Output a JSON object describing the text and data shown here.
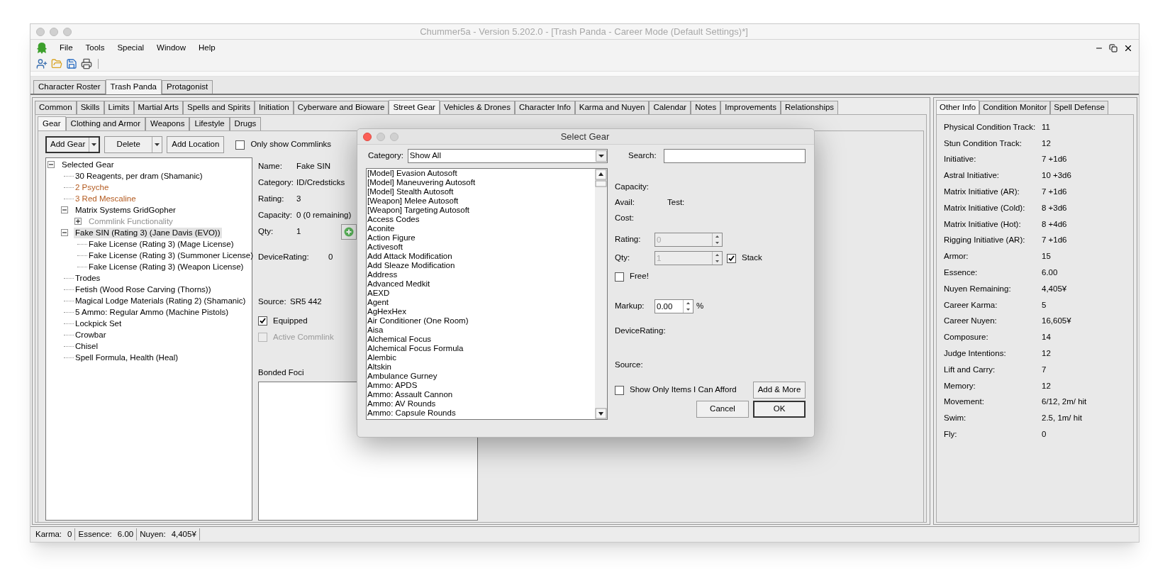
{
  "window": {
    "title": "Chummer5a - Version 5.202.0 - [Trash Panda - Career Mode (Default Settings)*]"
  },
  "menu": [
    "File",
    "Tools",
    "Special",
    "Window",
    "Help"
  ],
  "character_tabs": [
    {
      "label": "Character Roster",
      "selected": false
    },
    {
      "label": "Trash Panda",
      "selected": true
    },
    {
      "label": "Protagonist",
      "selected": false
    }
  ],
  "main_tabs": [
    {
      "label": "Common",
      "selected": false
    },
    {
      "label": "Skills",
      "selected": false
    },
    {
      "label": "Limits",
      "selected": false
    },
    {
      "label": "Martial Arts",
      "selected": false
    },
    {
      "label": "Spells and Spirits",
      "selected": false
    },
    {
      "label": "Initiation",
      "selected": false
    },
    {
      "label": "Cyberware and Bioware",
      "selected": false
    },
    {
      "label": "Street Gear",
      "selected": true
    },
    {
      "label": "Vehicles & Drones",
      "selected": false
    },
    {
      "label": "Character Info",
      "selected": false
    },
    {
      "label": "Karma and Nuyen",
      "selected": false
    },
    {
      "label": "Calendar",
      "selected": false
    },
    {
      "label": "Notes",
      "selected": false
    },
    {
      "label": "Improvements",
      "selected": false
    },
    {
      "label": "Relationships",
      "selected": false
    }
  ],
  "sub_tabs": [
    {
      "label": "Gear",
      "selected": true
    },
    {
      "label": "Clothing and Armor",
      "selected": false
    },
    {
      "label": "Weapons",
      "selected": false
    },
    {
      "label": "Lifestyle",
      "selected": false
    },
    {
      "label": "Drugs",
      "selected": false
    }
  ],
  "gear_toolbar": {
    "add_gear": "Add Gear",
    "delete": "Delete",
    "add_location": "Add Location",
    "only_commlinks": {
      "label": "Only show Commlinks",
      "checked": false
    }
  },
  "gear_tree": [
    {
      "label": "Selected Gear",
      "expanded": true,
      "selected": false,
      "children": [
        {
          "label": "30 Reagents, per dram (Shamanic)",
          "selected": false
        },
        {
          "label": "2 Psyche",
          "selected": false,
          "color": "#b35a1f"
        },
        {
          "label": "3 Red Mescaline",
          "selected": false,
          "color": "#b35a1f"
        },
        {
          "label": "Matrix Systems GridGopher",
          "expanded": true,
          "selected": false,
          "children": [
            {
              "label": "Commlink Functionality",
              "expanded": false,
              "selected": false,
              "color": "#909090"
            }
          ]
        },
        {
          "label": "Fake SIN (Rating 3) (Jane Davis (EVO))",
          "expanded": true,
          "selected": true,
          "children": [
            {
              "label": "Fake License (Rating 3) (Mage License)",
              "selected": false
            },
            {
              "label": "Fake License (Rating 3) (Summoner License)",
              "selected": false
            },
            {
              "label": "Fake License (Rating 3) (Weapon License)",
              "selected": false
            }
          ]
        },
        {
          "label": "Trodes",
          "selected": false
        },
        {
          "label": "Fetish (Wood Rose Carving (Thorns))",
          "selected": false
        },
        {
          "label": "Magical Lodge Materials (Rating 2) (Shamanic)",
          "selected": false
        },
        {
          "label": "5 Ammo: Regular Ammo (Machine Pistols)",
          "selected": false
        },
        {
          "label": "Lockpick Set",
          "selected": false
        },
        {
          "label": "Crowbar",
          "selected": false
        },
        {
          "label": "Chisel",
          "selected": false
        },
        {
          "label": "Spell Formula, Health (Heal)",
          "selected": false
        }
      ]
    }
  ],
  "details": {
    "fields": [
      {
        "label": "Name:",
        "value": "Fake SIN"
      },
      {
        "label": "Category:",
        "value": "ID/Credsticks"
      },
      {
        "label": "Rating:",
        "value": "3"
      },
      {
        "label": "Capacity:",
        "value": "0 (0 remaining)"
      }
    ],
    "qty": {
      "label": "Qty:",
      "value": "1"
    },
    "device_rating": {
      "label": "DeviceRating:",
      "value": "0"
    },
    "source": {
      "label": "Source:",
      "value": "SR5 442"
    },
    "equipped": {
      "label": "Equipped",
      "checked": true,
      "disabled": false
    },
    "active_commlink": {
      "label": "Active Commlink",
      "checked": false,
      "disabled": true
    },
    "bonded_foci": "Bonded Foci"
  },
  "side_tabs": [
    {
      "label": "Other Info",
      "selected": true
    },
    {
      "label": "Condition Monitor",
      "selected": false
    },
    {
      "label": "Spell Defense",
      "selected": false
    }
  ],
  "other_info": [
    {
      "label": "Physical Condition Track:",
      "value": "11"
    },
    {
      "label": "Stun Condition Track:",
      "value": "12"
    },
    {
      "label": "Initiative:",
      "value": "7 +1d6"
    },
    {
      "label": "Astral Initiative:",
      "value": "10 +3d6"
    },
    {
      "label": "Matrix Initiative (AR):",
      "value": "7 +1d6"
    },
    {
      "label": "Matrix Initiative (Cold):",
      "value": "8 +3d6"
    },
    {
      "label": "Matrix Initiative (Hot):",
      "value": "8 +4d6"
    },
    {
      "label": "Rigging Initiative (AR):",
      "value": "7 +1d6"
    },
    {
      "label": "Armor:",
      "value": "15"
    },
    {
      "label": "Essence:",
      "value": "6.00"
    },
    {
      "label": "Nuyen Remaining:",
      "value": "4,405¥"
    },
    {
      "label": "Career Karma:",
      "value": "5"
    },
    {
      "label": "Career Nuyen:",
      "value": "16,605¥"
    },
    {
      "label": "Composure:",
      "value": "14"
    },
    {
      "label": "Judge Intentions:",
      "value": "12"
    },
    {
      "label": "Lift and Carry:",
      "value": "7"
    },
    {
      "label": "Memory:",
      "value": "12"
    },
    {
      "label": "Movement:",
      "value": "6/12, 2m/ hit"
    },
    {
      "label": "Swim:",
      "value": "2.5, 1m/ hit"
    },
    {
      "label": "Fly:",
      "value": "0"
    }
  ],
  "status_bar": [
    {
      "label": "Karma:",
      "value": "0"
    },
    {
      "label": "Essence:",
      "value": "6.00"
    },
    {
      "label": "Nuyen:",
      "value": "4,405¥"
    }
  ],
  "dialog": {
    "title": "Select Gear",
    "category": {
      "label": "Category:",
      "value": "Show All"
    },
    "search": {
      "label": "Search:"
    },
    "items": [
      "[Model] Evasion Autosoft",
      "[Model] Maneuvering Autosoft",
      "[Model] Stealth Autosoft",
      "[Weapon] Melee Autosoft",
      "[Weapon] Targeting Autosoft",
      "Access Codes",
      "Aconite",
      "Action Figure",
      "Activesoft",
      "Add Attack Modification",
      "Add Sleaze Modification",
      "Address",
      "Advanced Medkit",
      "AEXD",
      "Agent",
      "AgHexHex",
      "Air Conditioner (One Room)",
      "Aisa",
      "Alchemical Focus",
      "Alchemical Focus Formula",
      "Alembic",
      "Altskin",
      "Ambulance Gurney",
      "Ammo: APDS",
      "Ammo: Assault Cannon",
      "Ammo: AV Rounds",
      "Ammo: Capsule Rounds"
    ],
    "capacity": "Capacity:",
    "avail": "Avail:",
    "test": "Test:",
    "cost": "Cost:",
    "rating": {
      "label": "Rating:",
      "value": "0",
      "disabled": true
    },
    "qty": {
      "label": "Qty:",
      "value": "1",
      "disabled": true
    },
    "stack": {
      "label": "Stack",
      "checked": true
    },
    "free": {
      "label": "Free!",
      "checked": false
    },
    "markup": {
      "label": "Markup:",
      "value": "0.00",
      "unit": "%"
    },
    "device_rating": "DeviceRating:",
    "source": "Source:",
    "afford": {
      "label": "Show Only Items I Can Afford",
      "checked": false
    },
    "buttons": [
      {
        "label": "Add & More",
        "default": false
      },
      {
        "label": "Cancel",
        "default": false
      },
      {
        "label": "OK",
        "default": true
      }
    ]
  }
}
